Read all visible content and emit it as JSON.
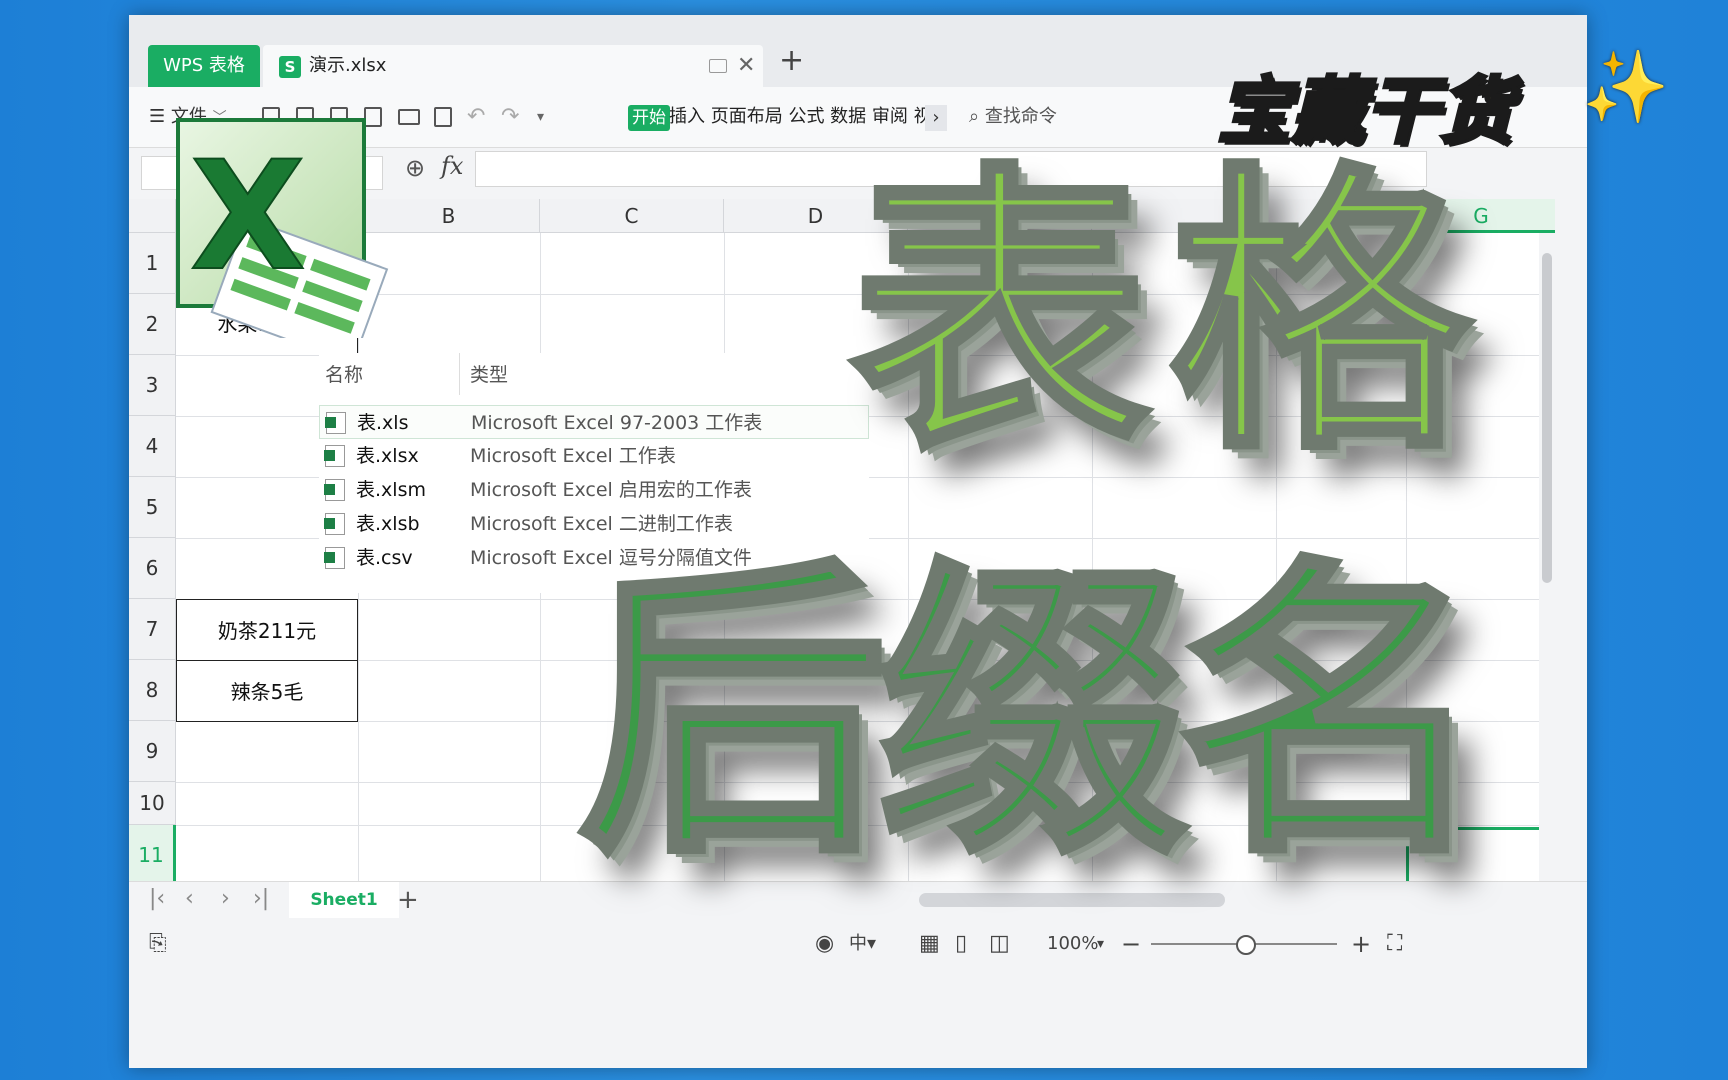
{
  "app_tab": "WPS 表格",
  "doc_tab": {
    "icon": "S",
    "title": "演示.xlsx"
  },
  "toolbar": {
    "menu": "文件",
    "start": "开始",
    "ribbon_tabs": "插入 页面布局 公式 数据 审阅 视",
    "more": "›",
    "search": "查找命令"
  },
  "formula_bar": {
    "fx": "fx"
  },
  "columns": [
    "B",
    "C",
    "D",
    "E",
    "G"
  ],
  "rows": [
    "1",
    "2",
    "3",
    "4",
    "5",
    "6",
    "7",
    "8",
    "9",
    "10",
    "11"
  ],
  "cells": {
    "a2": "水果135元",
    "a7": "奶茶211元",
    "a8": "辣条5毛"
  },
  "file_table": {
    "headers": {
      "name": "名称",
      "type": "类型"
    },
    "rows": [
      {
        "name": "表.xls",
        "type": "Microsoft Excel 97-2003 工作表"
      },
      {
        "name": "表.xlsx",
        "type": "Microsoft Excel 工作表"
      },
      {
        "name": "表.xlsm",
        "type": "Microsoft Excel 启用宏的工作表"
      },
      {
        "name": "表.xlsb",
        "type": "Microsoft Excel 二进制工作表"
      },
      {
        "name": "表.csv",
        "type": "Microsoft Excel 逗号分隔值文件"
      }
    ]
  },
  "sheet_tab": "Sheet1",
  "statusbar": {
    "zoom": "100%",
    "zoom_level": 0.5
  },
  "overlay": {
    "banner": "宝藏干货",
    "sparkle": "✨",
    "word1": "表格",
    "word2": "后缀名"
  },
  "colors": {
    "accent": "#1aad63",
    "banner": "#ffd23f",
    "title_green": "#86c54a"
  }
}
